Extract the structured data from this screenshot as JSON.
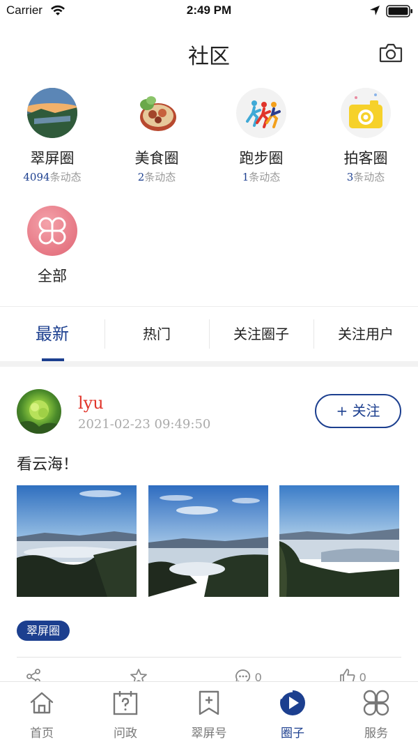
{
  "status_bar": {
    "carrier": "Carrier",
    "time": "2:49 PM"
  },
  "header": {
    "title": "社区",
    "camera_icon": "camera-icon"
  },
  "circles": [
    {
      "name": "翠屏圈",
      "count": "4094",
      "count_suffix": "条动态"
    },
    {
      "name": "美食圈",
      "count": "2",
      "count_suffix": "条动态"
    },
    {
      "name": "跑步圈",
      "count": "1",
      "count_suffix": "条动态"
    },
    {
      "name": "拍客圈",
      "count": "3",
      "count_suffix": "条动态"
    },
    {
      "name": "全部"
    }
  ],
  "tabs": [
    {
      "label": "最新",
      "active": true
    },
    {
      "label": "热门"
    },
    {
      "label": "关注圈子"
    },
    {
      "label": "关注用户"
    }
  ],
  "post": {
    "username": "lyu",
    "timestamp": "2021-02-23 09:49:50",
    "follow_label": "+ 关注",
    "text": "看云海！",
    "tag": "翠屏圈",
    "actions": [
      {
        "icon": "share-icon",
        "count": ""
      },
      {
        "icon": "star-icon",
        "count": ""
      },
      {
        "icon": "comment-icon",
        "count": "0"
      },
      {
        "icon": "thumbs-up-icon",
        "count": "0"
      }
    ]
  },
  "tab_bar": [
    {
      "label": "首页",
      "icon": "home-icon"
    },
    {
      "label": "问政",
      "icon": "question-calendar-icon"
    },
    {
      "label": "翠屏号",
      "icon": "bookmark-plus-icon"
    },
    {
      "label": "圈子",
      "icon": "circle-play-icon",
      "active": true
    },
    {
      "label": "服务",
      "icon": "grid-clover-icon"
    }
  ],
  "colors": {
    "accent": "#1c3f8f",
    "username": "#e0352b",
    "muted": "#999999"
  }
}
